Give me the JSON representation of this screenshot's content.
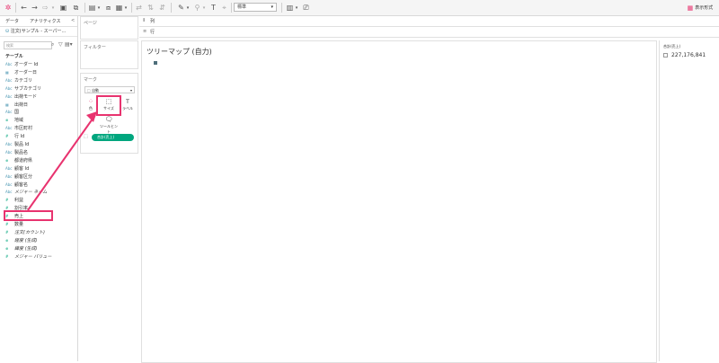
{
  "toolbar": {
    "fit_select": "標準",
    "show_me": "表示形式"
  },
  "side_panel": {
    "tabs": [
      "データ",
      "アナリティクス"
    ],
    "collapse": "<",
    "data_source": "注文(サンプル - スーパー...",
    "search_placeholder": "検索",
    "section_label": "テーブル",
    "fields": [
      {
        "type": "Abc",
        "label": "オーダー Id",
        "italic": false
      },
      {
        "type": "date",
        "label": "オーダー日",
        "italic": false
      },
      {
        "type": "Abc",
        "label": "カテゴリ",
        "italic": false
      },
      {
        "type": "Abc",
        "label": "サブカテゴリ",
        "italic": false
      },
      {
        "type": "Abc",
        "label": "出荷モード",
        "italic": false
      },
      {
        "type": "date",
        "label": "出荷日",
        "italic": false
      },
      {
        "type": "Abc",
        "label": "国",
        "italic": false
      },
      {
        "type": "geo",
        "label": "地域",
        "italic": false
      },
      {
        "type": "Abc",
        "label": "市区町村",
        "italic": false
      },
      {
        "type": "#",
        "label": "行 Id",
        "italic": false
      },
      {
        "type": "Abc",
        "label": "製品 Id",
        "italic": false
      },
      {
        "type": "Abc",
        "label": "製品名",
        "italic": false
      },
      {
        "type": "geo",
        "label": "都道府県",
        "italic": false
      },
      {
        "type": "Abc",
        "label": "顧客 Id",
        "italic": false
      },
      {
        "type": "Abc",
        "label": "顧客区分",
        "italic": false
      },
      {
        "type": "Abc",
        "label": "顧客名",
        "italic": false
      },
      {
        "type": "Abc",
        "label": "メジャー ネーム",
        "italic": true
      },
      {
        "type": "#",
        "label": "利益",
        "italic": false
      },
      {
        "type": "#",
        "label": "割引率",
        "italic": false
      },
      {
        "type": "#",
        "label": "売上",
        "italic": false
      },
      {
        "type": "#",
        "label": "数量",
        "italic": false
      },
      {
        "type": "#",
        "label": "注文(カウント)",
        "italic": true
      },
      {
        "type": "geo",
        "label": "経度 (生成)",
        "italic": true
      },
      {
        "type": "geo",
        "label": "緯度 (生成)",
        "italic": true
      },
      {
        "type": "#",
        "label": "メジャー バリュー",
        "italic": true
      }
    ]
  },
  "cards": {
    "pages": "ページ",
    "filters": "フィルター",
    "marks": "マーク",
    "mark_type": "自動",
    "mark_buttons": {
      "color": "色",
      "size": "サイズ",
      "label": "ラベル",
      "tooltip": "ツールヒント"
    },
    "size_pill": "合計(売上)"
  },
  "shelves": {
    "columns": "列",
    "rows": "行"
  },
  "view": {
    "title": "ツリーマップ (自力)"
  },
  "legend": {
    "title": "合計(売上)",
    "value": "227,176,841"
  },
  "colors": {
    "highlight": "#e8336f",
    "pill": "#00a67e",
    "accent": "#4996b2"
  }
}
